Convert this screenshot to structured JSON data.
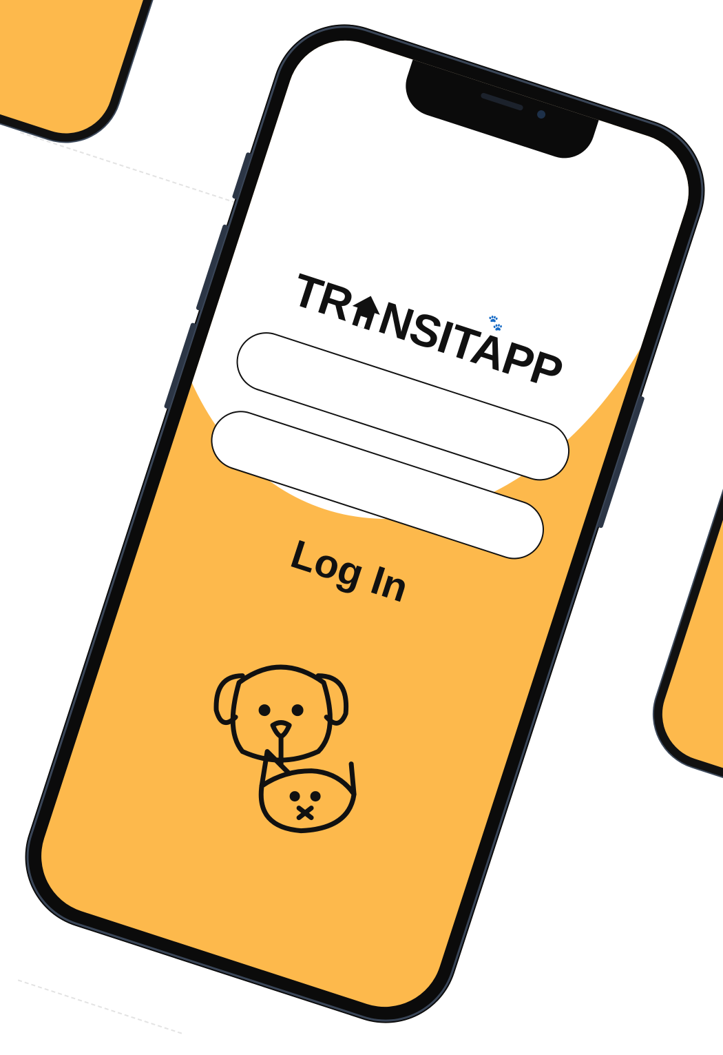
{
  "logo": {
    "text": "TRANSITAPP",
    "prefix": "TR",
    "suffix": "NSITAPP"
  },
  "form": {
    "username_placeholder": "",
    "password_placeholder": "",
    "login_label": "Log In"
  },
  "colors": {
    "accent": "#fdb94c",
    "frame": "#0b0b0b",
    "screen_top": "#ffffff",
    "text": "#111111"
  },
  "icons": [
    "house-icon",
    "paw-icon",
    "dog-cat-icon"
  ]
}
